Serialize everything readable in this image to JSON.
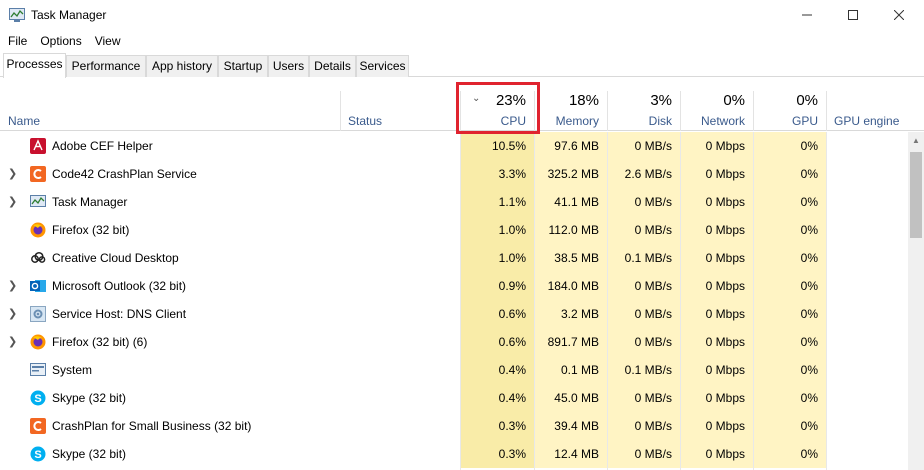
{
  "window": {
    "title": "Task Manager",
    "icon": "task-manager-icon"
  },
  "menu": [
    "File",
    "Options",
    "View"
  ],
  "tabs": [
    "Processes",
    "Performance",
    "App history",
    "Startup",
    "Users",
    "Details",
    "Services"
  ],
  "active_tab": "Processes",
  "columns": {
    "name": "Name",
    "status": "Status",
    "cpu": {
      "label": "CPU",
      "total": "23%",
      "sorted": true
    },
    "memory": {
      "label": "Memory",
      "total": "18%"
    },
    "disk": {
      "label": "Disk",
      "total": "3%"
    },
    "network": {
      "label": "Network",
      "total": "0%"
    },
    "gpu": {
      "label": "GPU",
      "total": "0%"
    },
    "gpu_engine": {
      "label": "GPU engine"
    }
  },
  "colors": {
    "heat_cpu": "#f9eca8",
    "heat_light": "#fff4c4",
    "highlight": "#e0232f"
  },
  "processes": [
    {
      "name": "Adobe CEF Helper",
      "expandable": false,
      "icon": "adobe-cef-icon",
      "cpu": "10.5%",
      "memory": "97.6 MB",
      "disk": "0 MB/s",
      "network": "0 Mbps",
      "gpu": "0%"
    },
    {
      "name": "Code42 CrashPlan Service",
      "expandable": true,
      "icon": "crashplan-icon",
      "cpu": "3.3%",
      "memory": "325.2 MB",
      "disk": "2.6 MB/s",
      "network": "0 Mbps",
      "gpu": "0%"
    },
    {
      "name": "Task Manager",
      "expandable": true,
      "icon": "task-manager-icon",
      "cpu": "1.1%",
      "memory": "41.1 MB",
      "disk": "0 MB/s",
      "network": "0 Mbps",
      "gpu": "0%"
    },
    {
      "name": "Firefox (32 bit)",
      "expandable": false,
      "icon": "firefox-icon",
      "cpu": "1.0%",
      "memory": "112.0 MB",
      "disk": "0 MB/s",
      "network": "0 Mbps",
      "gpu": "0%"
    },
    {
      "name": "Creative Cloud Desktop",
      "expandable": false,
      "icon": "creative-cloud-icon",
      "cpu": "1.0%",
      "memory": "38.5 MB",
      "disk": "0.1 MB/s",
      "network": "0 Mbps",
      "gpu": "0%"
    },
    {
      "name": "Microsoft Outlook (32 bit)",
      "expandable": true,
      "icon": "outlook-icon",
      "cpu": "0.9%",
      "memory": "184.0 MB",
      "disk": "0 MB/s",
      "network": "0 Mbps",
      "gpu": "0%"
    },
    {
      "name": "Service Host: DNS Client",
      "expandable": true,
      "icon": "service-host-icon",
      "cpu": "0.6%",
      "memory": "3.2 MB",
      "disk": "0 MB/s",
      "network": "0 Mbps",
      "gpu": "0%"
    },
    {
      "name": "Firefox (32 bit) (6)",
      "expandable": true,
      "icon": "firefox-icon",
      "cpu": "0.6%",
      "memory": "891.7 MB",
      "disk": "0 MB/s",
      "network": "0 Mbps",
      "gpu": "0%"
    },
    {
      "name": "System",
      "expandable": false,
      "icon": "system-icon",
      "cpu": "0.4%",
      "memory": "0.1 MB",
      "disk": "0.1 MB/s",
      "network": "0 Mbps",
      "gpu": "0%"
    },
    {
      "name": "Skype (32 bit)",
      "expandable": false,
      "icon": "skype-icon",
      "cpu": "0.4%",
      "memory": "45.0 MB",
      "disk": "0 MB/s",
      "network": "0 Mbps",
      "gpu": "0%"
    },
    {
      "name": "CrashPlan for Small Business (32 bit)",
      "expandable": false,
      "icon": "crashplan-icon",
      "cpu": "0.3%",
      "memory": "39.4 MB",
      "disk": "0 MB/s",
      "network": "0 Mbps",
      "gpu": "0%"
    },
    {
      "name": "Skype (32 bit)",
      "expandable": false,
      "icon": "skype-icon",
      "cpu": "0.3%",
      "memory": "12.4 MB",
      "disk": "0 MB/s",
      "network": "0 Mbps",
      "gpu": "0%"
    }
  ]
}
